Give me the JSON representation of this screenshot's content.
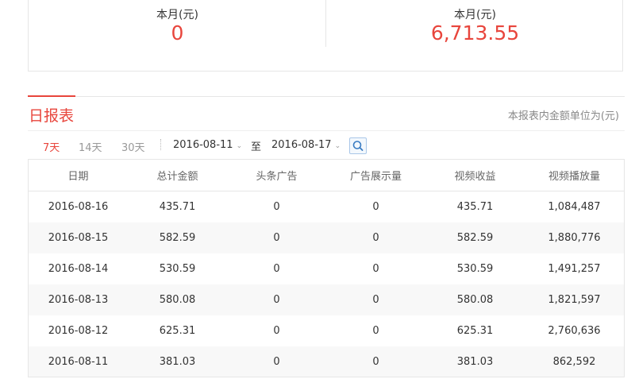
{
  "summary": {
    "left": {
      "label": "本月(元)",
      "value": "0"
    },
    "right": {
      "label": "本月(元)",
      "value": "6,713.55"
    }
  },
  "report": {
    "title": "日报表",
    "unit_note": "本报表内金额单位为(元)",
    "range_tabs": [
      "7天",
      "14天",
      "30天"
    ],
    "active_tab": "7天",
    "start_date": "2016-08-11",
    "to_label": "至",
    "end_date": "2016-08-17"
  },
  "table": {
    "columns": [
      "日期",
      "总计金额",
      "头条广告",
      "广告展示量",
      "视频收益",
      "视频播放量"
    ],
    "rows": [
      [
        "2016-08-16",
        "435.71",
        "0",
        "0",
        "435.71",
        "1,084,487"
      ],
      [
        "2016-08-15",
        "582.59",
        "0",
        "0",
        "582.59",
        "1,880,776"
      ],
      [
        "2016-08-14",
        "530.59",
        "0",
        "0",
        "530.59",
        "1,491,257"
      ],
      [
        "2016-08-13",
        "580.08",
        "0",
        "0",
        "580.08",
        "1,821,597"
      ],
      [
        "2016-08-12",
        "625.31",
        "0",
        "0",
        "625.31",
        "2,760,636"
      ],
      [
        "2016-08-11",
        "381.03",
        "0",
        "0",
        "381.03",
        "862,592"
      ]
    ]
  },
  "colors": {
    "accent": "#e8453c",
    "border": "#e6e6e6",
    "stripe": "#f8f8f8"
  }
}
